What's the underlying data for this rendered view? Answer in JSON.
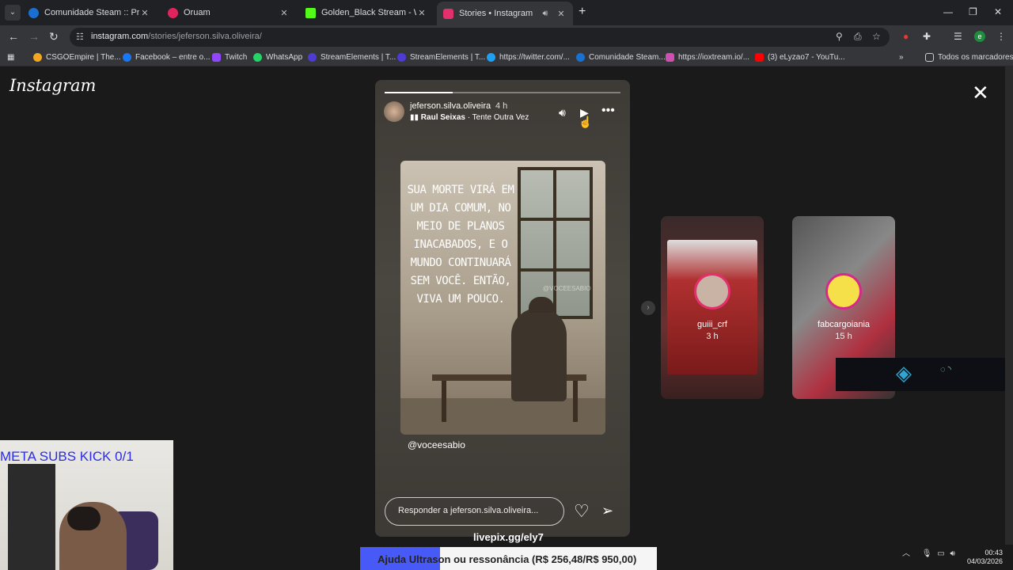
{
  "browser": {
    "tabs": [
      {
        "title": "Comunidade Steam :: Proposta",
        "favicon_color": "#1b6fd1",
        "active": false
      },
      {
        "title": "Oruam",
        "favicon_color": "#e0245e",
        "active": false
      },
      {
        "title": "Golden_Black Stream - Watch L",
        "favicon_color": "#53fc18",
        "active": false
      },
      {
        "title": "Stories • Instagram",
        "favicon_color": "#e1306c",
        "active": true
      }
    ],
    "url": {
      "host": "instagram.com",
      "path": "/stories/jeferson.silva.oliveira/"
    },
    "profile_initial": "e",
    "bookmarks": [
      {
        "label": "CSGOEmpire | The...",
        "color": "#f5a623"
      },
      {
        "label": "Facebook – entre o...",
        "color": "#1877f2"
      },
      {
        "label": "Twitch",
        "color": "#9146ff"
      },
      {
        "label": "WhatsApp",
        "color": "#25d366"
      },
      {
        "label": "StreamElements | T...",
        "color": "#4d3bd4"
      },
      {
        "label": "StreamElements | T...",
        "color": "#4d3bd4"
      },
      {
        "label": "https://twitter.com/...",
        "color": "#1da1f2"
      },
      {
        "label": "Comunidade Steam...",
        "color": "#1b6fd1"
      },
      {
        "label": "https://ioxtream.io/...",
        "color": "#d04fb5"
      },
      {
        "label": "(3) eLyzao7 - YouTu...",
        "color": "#ff0000"
      }
    ],
    "all_bookmarks": "Todos os marcadores"
  },
  "instagram": {
    "logo": "Instagram",
    "story": {
      "progress": 0.29,
      "username": "jeferson.silva.oliveira",
      "time": "4 h",
      "music_artist": "Raul Seixas",
      "music_song": " · Tente Outra Vez",
      "quote_lines": [
        "SUA MORTE VIRÁ EM",
        "UM DIA COMUM, NO",
        "MEIO DE PLANOS",
        "INACABADOS, E O",
        "MUNDO CONTINUARÁ",
        "SEM VOCÊ. ENTÃO,",
        "VIVA UM POUCO."
      ],
      "watermark": "@VOCEESABIO",
      "mention": "@voceesabio",
      "reply_placeholder": "Responder a jeferson.silva.oliveira..."
    },
    "previews": [
      {
        "name": "guiii_crf",
        "time": "3 h"
      },
      {
        "name": "fabcargoiania",
        "time": "15 h"
      }
    ]
  },
  "overlay": {
    "kick_counter": "META SUBS KICK 0/1",
    "livepix": "livepix.gg/ely7",
    "goal_text": "Ajuda Ultrason ou ressonância (R$ 256,48/R$ 950,00)",
    "goal_progress": 0.27
  },
  "system": {
    "time": "00:43",
    "date": "04/03/2026"
  }
}
